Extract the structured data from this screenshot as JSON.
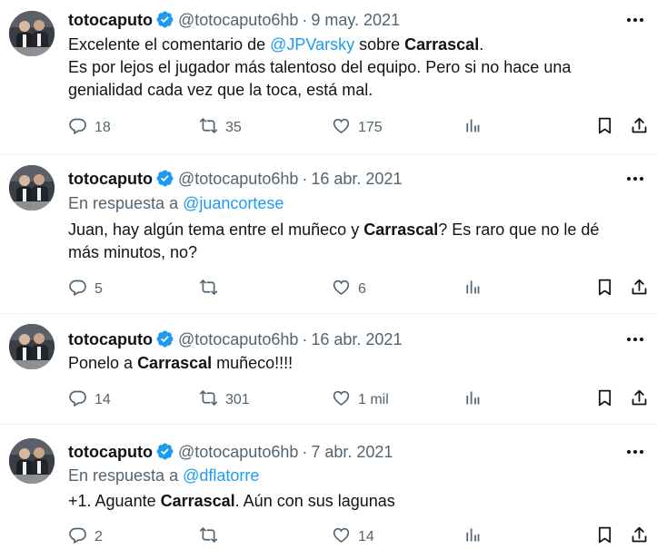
{
  "tweets": [
    {
      "name": "totocaputo",
      "handle": "@totocaputo6hb",
      "date": "9 may. 2021",
      "reply_prefix": "",
      "reply_to": "",
      "text_lines": [
        [
          {
            "t": "Excelente el comentario de "
          },
          {
            "t": "@JPVarsky",
            "link": true
          },
          {
            "t": "  sobre "
          },
          {
            "t": "Carrascal",
            "bold": true
          },
          {
            "t": "."
          }
        ],
        [
          {
            "t": "Es por lejos el jugador más talentoso del equipo. Pero si no hace una"
          }
        ],
        [
          {
            "t": "genialidad cada vez que la toca, está mal."
          }
        ]
      ],
      "replies": "18",
      "retweets": "35",
      "likes": "175"
    },
    {
      "name": "totocaputo",
      "handle": "@totocaputo6hb",
      "date": "16 abr. 2021",
      "reply_prefix": "En respuesta a ",
      "reply_to": "@juancortese",
      "text_lines": [
        [
          {
            "t": "Juan, hay algún tema entre el muñeco y "
          },
          {
            "t": "Carrascal",
            "bold": true
          },
          {
            "t": "? Es raro que no le dé"
          }
        ],
        [
          {
            "t": "más minutos, no?"
          }
        ]
      ],
      "replies": "5",
      "retweets": "",
      "likes": "6"
    },
    {
      "name": "totocaputo",
      "handle": "@totocaputo6hb",
      "date": "16 abr. 2021",
      "reply_prefix": "",
      "reply_to": "",
      "text_lines": [
        [
          {
            "t": "Ponelo a "
          },
          {
            "t": "Carrascal",
            "bold": true
          },
          {
            "t": " muñeco!!!!"
          }
        ]
      ],
      "replies": "14",
      "retweets": "301",
      "likes": "1 mil"
    },
    {
      "name": "totocaputo",
      "handle": "@totocaputo6hb",
      "date": "7 abr. 2021",
      "reply_prefix": "En respuesta a ",
      "reply_to": "@dflatorre",
      "text_lines": [
        [
          {
            "t": "+1. Aguante "
          },
          {
            "t": "Carrascal",
            "bold": true
          },
          {
            "t": ". Aún con sus lagunas"
          }
        ]
      ],
      "replies": "2",
      "retweets": "",
      "likes": "14"
    }
  ],
  "colors": {
    "text": "#0f1419",
    "muted": "#536471",
    "link": "#1d9bf0",
    "verified": "#1d9bf0",
    "divider": "#eff3f4"
  },
  "icons": [
    "reply-icon",
    "retweet-icon",
    "like-icon",
    "views-icon",
    "bookmark-icon",
    "share-icon",
    "verified-badge-icon",
    "more-icon"
  ]
}
